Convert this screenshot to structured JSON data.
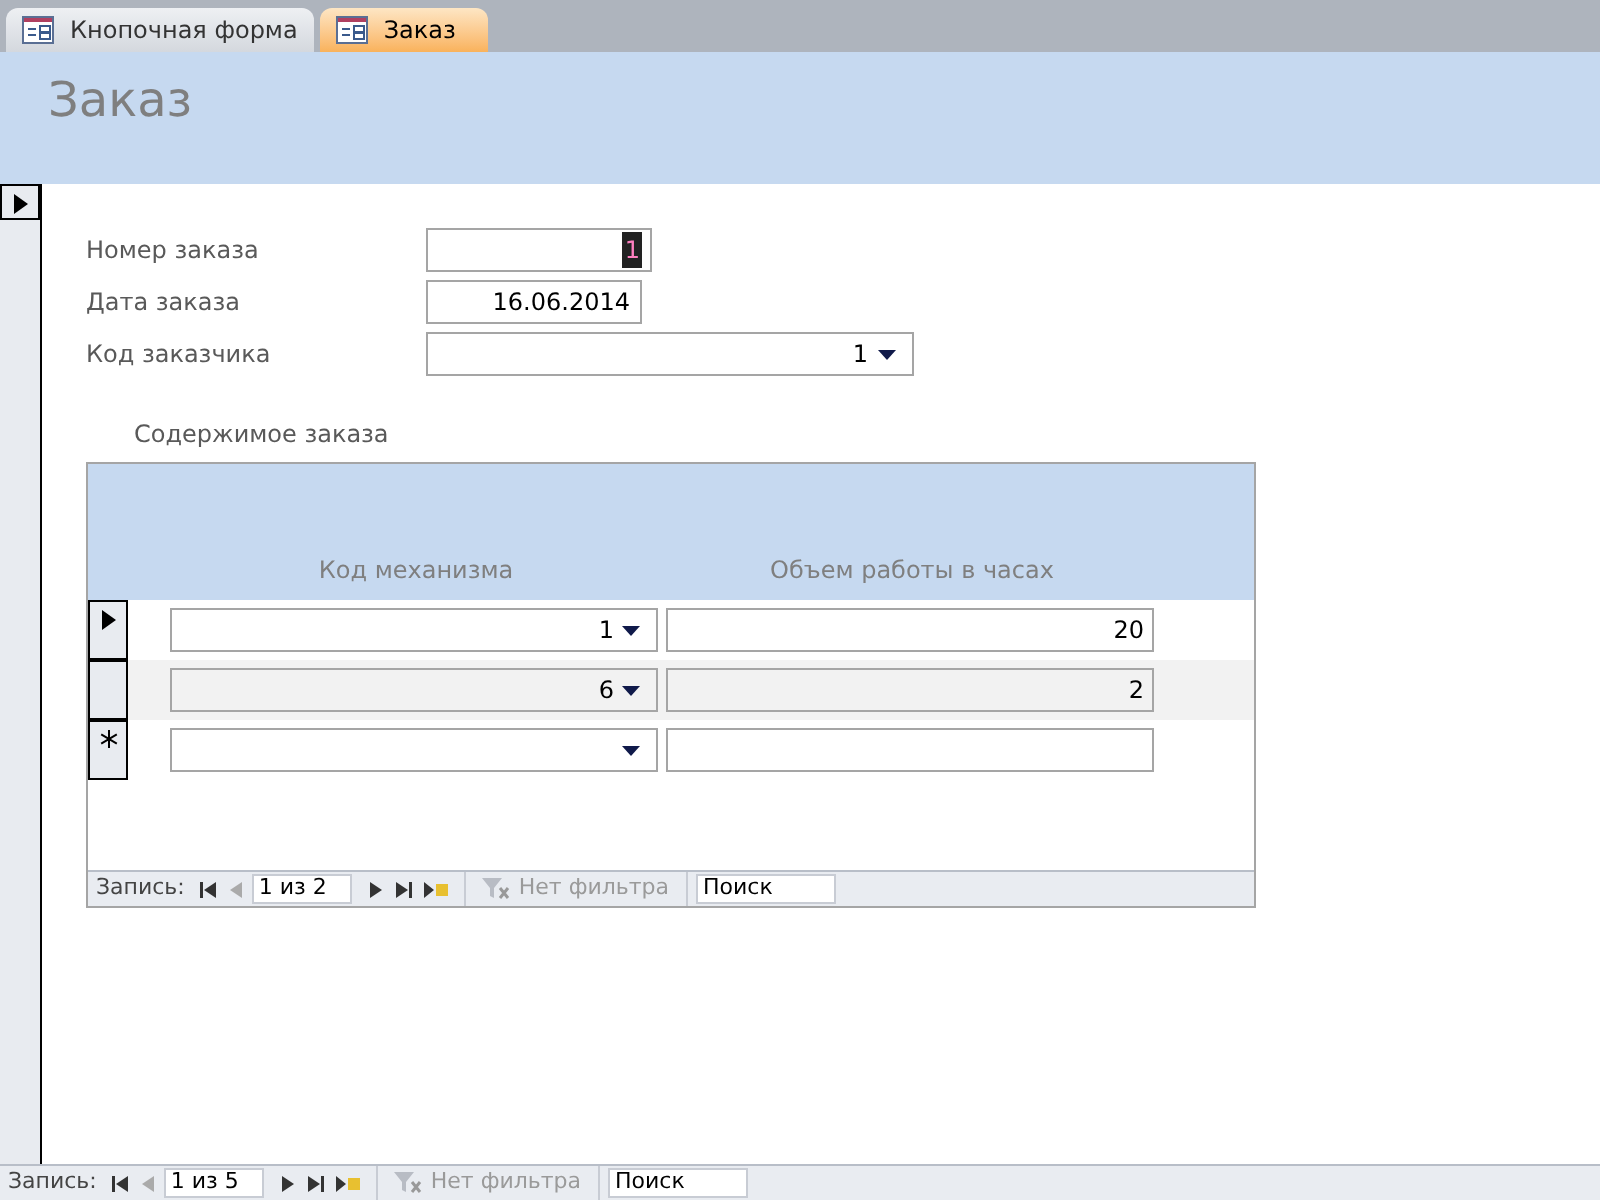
{
  "tabs": [
    {
      "label": "Кнопочная форма",
      "selected": false
    },
    {
      "label": "Заказ",
      "selected": true
    }
  ],
  "form": {
    "title": "Заказ",
    "fields": [
      {
        "label": "Номер заказа",
        "value": "1",
        "kind": "text",
        "highlighted": true
      },
      {
        "label": "Дата заказа",
        "value": "16.06.2014",
        "kind": "text",
        "highlighted": false
      },
      {
        "label": "Код заказчика",
        "value": "1",
        "kind": "combo",
        "highlighted": false
      }
    ],
    "subform": {
      "title": "Содержимое заказа",
      "columns": [
        "Код механизма",
        "Объем работы в часах"
      ],
      "rows": [
        {
          "kind": "current",
          "cells": [
            "1",
            "20"
          ]
        },
        {
          "kind": "plain",
          "cells": [
            "6",
            "2"
          ]
        },
        {
          "kind": "new",
          "cells": [
            "",
            ""
          ]
        }
      ],
      "navigation": {
        "label": "Запись:",
        "position": "1 из 2",
        "filter": "Нет фильтра",
        "search": "Поиск"
      }
    }
  },
  "navigation": {
    "label": "Запись:",
    "position": "1 из 5",
    "filter": "Нет фильтра",
    "search": "Поиск"
  }
}
